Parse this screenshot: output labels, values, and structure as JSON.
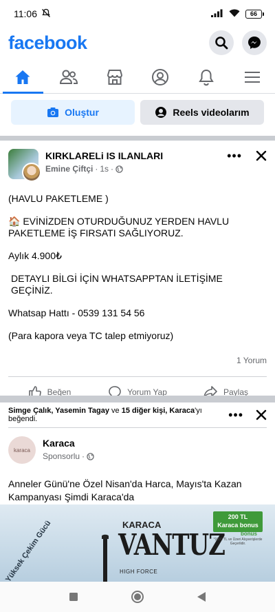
{
  "status_bar": {
    "time": "11:06",
    "battery": "66"
  },
  "header": {
    "logo": "facebook"
  },
  "composer": {
    "create_label": "Oluştur",
    "reels_label": "Reels videolarım"
  },
  "post1": {
    "group_name": "KIRKLARELi IS ILANLARI",
    "author": "Emine Çiftçi",
    "time": "1s",
    "lines": [
      "(HAVLU PAKETLEME )",
      "🏠 EVİNİZDEN OTURDUĞUNUZ YERDEN HAVLU PAKETLEME İŞ FIRSATI SAĞLIYORUZ.",
      "Aylık 4.900₺",
      "DETAYLI BİLGİ İÇİN WHATSAPPTAN İLETİŞİME GEÇİNİZ.",
      "Whatsap Hattı - 0539 131 54 56",
      "(Para kapora veya TC talep etmiyoruz)"
    ],
    "comments": "1 Yorum",
    "actions": {
      "like": "Beğen",
      "comment": "Yorum Yap",
      "share": "Paylaş"
    }
  },
  "post2": {
    "liked_names": "Simge Çalık, Yasemin Tagay",
    "liked_and": "ve",
    "liked_others": "15 diğer kişi,",
    "liked_page": "Karaca",
    "liked_suffix": "'yı beğendi.",
    "page_name": "Karaca",
    "avatar_text": "karaca",
    "sponsored": "Sponsorlu",
    "text": "Anneler Günü'ne Özel Nisan'da Harca, Mayıs'ta Kazan Kampanyası Şimdi Karaca'da",
    "ad": {
      "brand": "KARACA",
      "product": "VANTUZ",
      "subline": "HIGH FORCE",
      "badge_line1": "200 TL",
      "badge_line2": "Karaca bonus",
      "bonus": "bonus",
      "fine_print": "*1000 TL ve Üzeri Alışverişlerde Geçerlidir.",
      "arc_text": "Yüksek Çekim Gücü"
    }
  },
  "colors": {
    "brand": "#1877f2",
    "muted": "#65676b",
    "separator": "#c9ccd1"
  }
}
